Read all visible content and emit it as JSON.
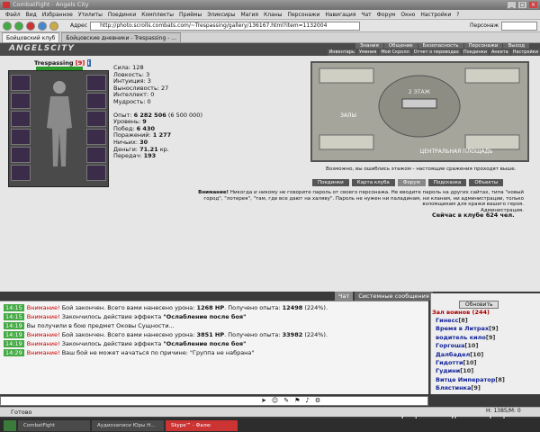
{
  "window": {
    "title": "CombatFight - Angels City"
  },
  "menu": [
    "Файл",
    "Вид",
    "Избранное",
    "Утилиты",
    "Поединки",
    "Комплекты",
    "Приёмы",
    "Эликсиры",
    "Магия",
    "Кланы",
    "Персонажи",
    "Навигация",
    "Чат",
    "Форум",
    "Окно",
    "Настройки",
    "?"
  ],
  "toolbar": {
    "address_label": "Адрес",
    "address": "http://photo.scrolls.combats.com/~Trespassing/gallery/136167.html?item=1132004",
    "search_label": "Персонаж"
  },
  "tabs": [
    "Бойцовский клуб",
    "Бойцовские дневники - Trespassing - ..."
  ],
  "site": {
    "logo": "ANGELSCITY",
    "nav_top": [
      "Знания",
      "Общение",
      "Безопасность",
      "Персонажи",
      "Выход"
    ],
    "nav_bottom": [
      "Инвентарь",
      "Умения",
      "Мой Скролл",
      "Отчет о переводах",
      "Поединки",
      "Анкета",
      "Настройки"
    ]
  },
  "character": {
    "name": "Trespassing",
    "level": "[9]",
    "stats": [
      {
        "label": "Сила:",
        "value": "128"
      },
      {
        "label": "Ловкость:",
        "value": "3"
      },
      {
        "label": "Интуиция:",
        "value": "3"
      },
      {
        "label": "Выносливость:",
        "value": "27"
      },
      {
        "label": "Интеллект:",
        "value": "0"
      },
      {
        "label": "Мудрость:",
        "value": "0"
      }
    ],
    "progress": [
      {
        "label": "Опыт:",
        "value": "6 282 506",
        "extra": "(6 500 000)"
      },
      {
        "label": "Уровень:",
        "value": "9"
      },
      {
        "label": "Побед:",
        "value": "6 430"
      },
      {
        "label": "Поражений:",
        "value": "1 277"
      },
      {
        "label": "Ничьих:",
        "value": "30"
      },
      {
        "label": "Деньги:",
        "value": "71.21",
        "extra": "кр."
      },
      {
        "label": "Передач:",
        "value": "193"
      }
    ]
  },
  "map": {
    "caption": "Возможно, вы ошиблись этажом - настоящие сражения проходят выше.",
    "labels": [
      "2 ЭТАЖ",
      "ЗАЛЫ",
      "ЦЕНТРАЛЬНАЯ ПЛОЩАДЬ"
    ],
    "buttons": [
      "Поединки",
      "Карта клуба",
      "Форум",
      "Подсказка",
      "Объекты"
    ]
  },
  "warning": {
    "bold": "Внимание!",
    "text": "Никогда и никому не говорите пароль от своего персонажа. Не вводите пароль на других сайтах, типа \"новый город\", \"лотерея\", \"там, где все дают на халяву\". Пароль не нужен ни паладинам, ни кланам, ни администрации, только взломщикам для кражи вашего героя.",
    "sign": "Администрация.",
    "online": "Сейчас в клубе 624 чел."
  },
  "chat": {
    "tabs": [
      "Чат",
      "Системные сообщения"
    ],
    "lines": [
      {
        "time": "14:15",
        "prefix": "Внимание!",
        "text": "Бой закончен. Всего вами нанесено урона: ",
        "b1": "1268 HP",
        "mid": ". Получено опыта: ",
        "b2": "12498",
        "tail": " (224%)."
      },
      {
        "time": "14:15",
        "prefix": "Внимание!",
        "text": "Закончилось действие эффекта ",
        "b1": "\"Ослабление после боя\"",
        "mid": "",
        "b2": "",
        "tail": ""
      },
      {
        "time": "14:19",
        "prefix": "",
        "text": "Вы получили в бою предмет Оковы Сущности...",
        "b1": "",
        "mid": "",
        "b2": "",
        "tail": ""
      },
      {
        "time": "14:19",
        "prefix": "Внимание!",
        "text": "Бой закончен. Всего вами нанесено урона: ",
        "b1": "3851 HP",
        "mid": ". Получено опыта: ",
        "b2": "33982",
        "tail": " (224%)."
      },
      {
        "time": "14:19",
        "prefix": "Внимание!",
        "text": "Закончилось действие эффекта ",
        "b1": "\"Ослабление после боя\"",
        "mid": "",
        "b2": "",
        "tail": ""
      },
      {
        "time": "14:29",
        "prefix": "Внимание!",
        "text": "Ваш бой не может начаться по причине: \"Группа не набрана\"",
        "b1": "",
        "mid": "",
        "b2": "",
        "tail": ""
      }
    ]
  },
  "roster": {
    "refresh": "Обновить",
    "title": "Зал воинов (244)",
    "players": [
      {
        "name": "Гинесс",
        "lvl": "[8]"
      },
      {
        "name": "Время в Литрах",
        "lvl": "[9]"
      },
      {
        "name": "водитель кило",
        "lvl": "[9]"
      },
      {
        "name": "Горгоша",
        "lvl": "[10]"
      },
      {
        "name": "Далбадел",
        "lvl": "[10]"
      },
      {
        "name": "Гидотти",
        "lvl": "[10]"
      },
      {
        "name": "Гудини",
        "lvl": "[10]"
      },
      {
        "name": "Витце Император",
        "lvl": "[8]"
      },
      {
        "name": "Блястинка",
        "lvl": "[9]"
      }
    ]
  },
  "statusbar": {
    "text": "Готово",
    "ping": "Н: 1385/М: 0",
    "watermark": "photo.scrolls.combats.com"
  },
  "taskbar": [
    "CombatFight",
    "Аудиозаписи Юры Н...",
    "Skype™ - Фалю"
  ]
}
